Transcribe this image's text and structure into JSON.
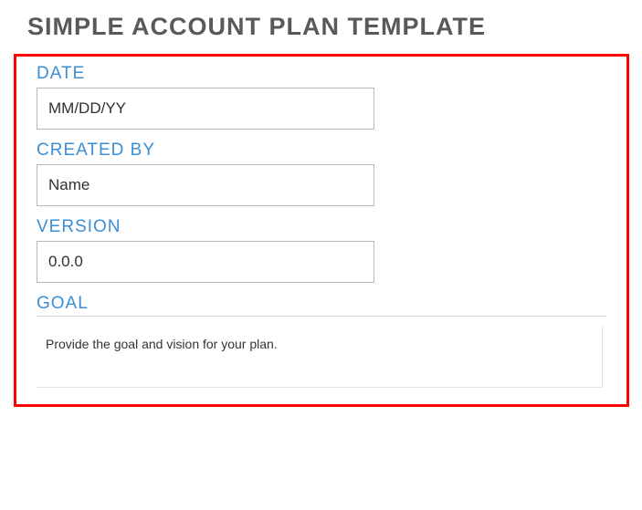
{
  "title": "SIMPLE ACCOUNT PLAN TEMPLATE",
  "fields": {
    "date": {
      "label": "DATE",
      "placeholder": "MM/DD/YY"
    },
    "created_by": {
      "label": "CREATED BY",
      "placeholder": "Name"
    },
    "version": {
      "label": "VERSION",
      "placeholder": "0.0.0"
    },
    "goal": {
      "label": "GOAL",
      "placeholder": "Provide the goal and vision for your plan."
    }
  }
}
